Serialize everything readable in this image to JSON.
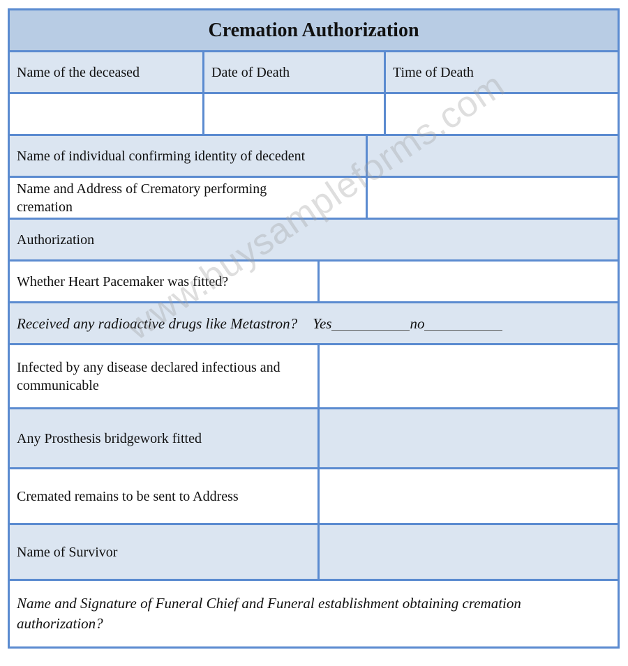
{
  "form": {
    "title": "Cremation Authorization",
    "fields": {
      "name_deceased": {
        "label": "Name of the deceased",
        "value": ""
      },
      "date_of_death": {
        "label": "Date of Death",
        "value": ""
      },
      "time_of_death": {
        "label": "Time of Death",
        "value": ""
      },
      "identity_confirmer": {
        "label": "Name of individual confirming identity of decedent",
        "value": ""
      },
      "crematory": {
        "label": "Name and Address of Crematory performing cremation",
        "value": ""
      },
      "authorization_section": "Authorization",
      "pacemaker": {
        "label": "Whether Heart Pacemaker was fitted?",
        "value": ""
      },
      "radioactive": {
        "label": "Received any radioactive drugs like Metastron?",
        "yes_label": "Yes",
        "no_label": "no",
        "yes_value": "",
        "no_value": ""
      },
      "infectious": {
        "label": "Infected by any disease declared infectious and communicable",
        "value": ""
      },
      "prosthesis": {
        "label": "Any Prosthesis bridgework fitted",
        "value": ""
      },
      "remains_address": {
        "label": "Cremated remains to be sent to Address",
        "value": ""
      },
      "survivor": {
        "label": "Name of Survivor",
        "value": ""
      },
      "funeral_chief": {
        "label": "Name and Signature of Funeral Chief and Funeral establishment obtaining cremation authorization?"
      }
    }
  },
  "watermark": "www.buysampleforms.com",
  "colors": {
    "border": "#5b8bd0",
    "header_bg": "#b8cce4",
    "row_bg": "#dbe5f1"
  }
}
